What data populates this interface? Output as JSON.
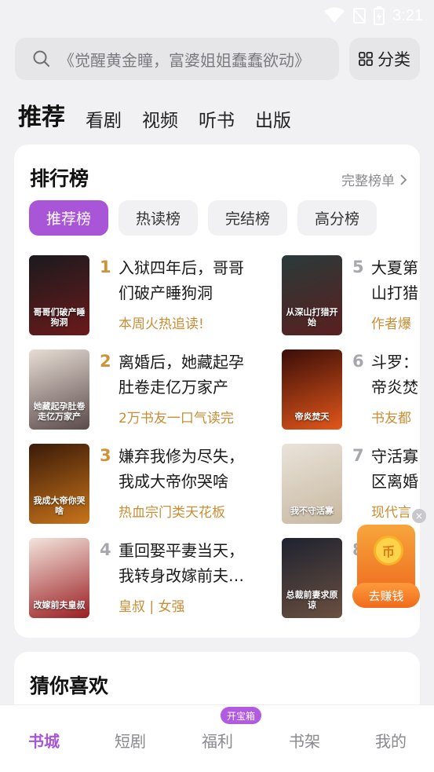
{
  "status_bar": {
    "time": "3:21"
  },
  "search": {
    "placeholder": "《觉醒黄金瞳，富婆姐姐蠢蠢欲动》",
    "category_label": "分类"
  },
  "top_tabs": [
    "推荐",
    "看剧",
    "视频",
    "听书",
    "出版"
  ],
  "ranking": {
    "title": "排行榜",
    "more_label": "完整榜单",
    "tabs": [
      "推荐榜",
      "热读榜",
      "完结榜",
      "高分榜"
    ],
    "books": [
      {
        "rank": "1",
        "title": "入狱四年后，哥哥\n们破产睡狗洞",
        "tag": "本周火热追读!",
        "cover_text": "哥哥们破产睡狗洞",
        "cover_colors": [
          "#1a1a1e",
          "#6b1a1a"
        ]
      },
      {
        "rank": "2",
        "title": "离婚后，她藏起孕\n肚卷走亿万家产",
        "tag": "2万书友一口气读完",
        "cover_text": "她藏起孕肚卷走亿万家产",
        "cover_colors": [
          "#e8ddd5",
          "#5a4a4a"
        ]
      },
      {
        "rank": "3",
        "title": "嫌弃我修为尽失，\n我成大帝你哭啥",
        "tag": "热血宗门类天花板",
        "cover_text": "我成大帝你哭啥",
        "cover_colors": [
          "#3a1a08",
          "#c8741a"
        ]
      },
      {
        "rank": "4",
        "title": "重回娶平妻当天，\n我转身改嫁前夫…",
        "tag": "皇叔 | 女强",
        "cover_text": "改嫁前夫皇叔",
        "cover_colors": [
          "#f3e4dc",
          "#9a1e22"
        ]
      },
      {
        "rank": "5",
        "title": "大夏第\n山打猎",
        "tag": "作者爆",
        "cover_text": "从深山打猎开始",
        "cover_colors": [
          "#2a3a3a",
          "#5a1f1f"
        ]
      },
      {
        "rank": "6",
        "title": "斗罗：\n帝炎焚",
        "tag": "书友都",
        "cover_text": "帝炎焚天",
        "cover_colors": [
          "#3a0d08",
          "#e2571a"
        ]
      },
      {
        "rank": "7",
        "title": "守活寡\n区离婚",
        "tag": "现代言",
        "cover_text": "我不守活寡",
        "cover_colors": [
          "#e9e3da",
          "#c8b8a0"
        ]
      },
      {
        "rank": "8",
        "title": "",
        "tag": "",
        "cover_text": "总裁前妻求原谅",
        "cover_colors": [
          "#1e2230",
          "#6a5040"
        ]
      }
    ]
  },
  "float_widget": {
    "label": "去赚钱",
    "coin_label": "币",
    "close_label": "×"
  },
  "guess": {
    "title": "猜你喜欢"
  },
  "bottom_nav": {
    "items": [
      "书城",
      "短剧",
      "福利",
      "书架",
      "我的"
    ],
    "badge": "开宝箱"
  },
  "colors": {
    "accent": "#a855d8",
    "rank_gold": "#d09236",
    "float_orange": "#f06b1b"
  }
}
